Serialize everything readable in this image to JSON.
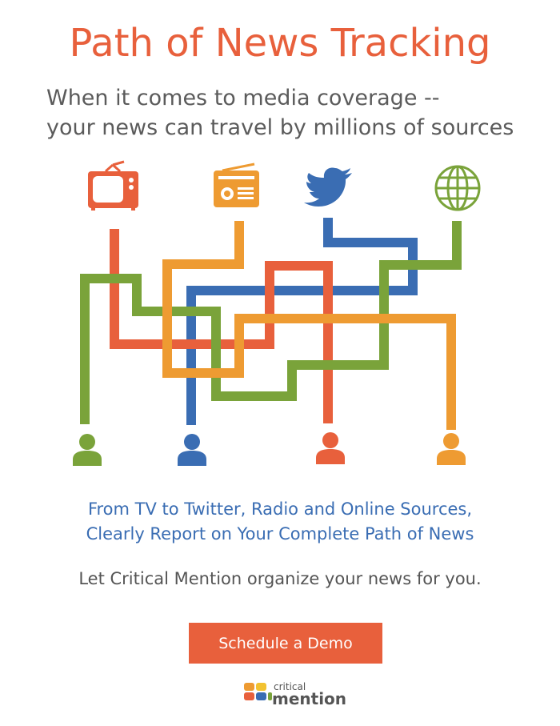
{
  "header": {
    "title": "Path of News Tracking",
    "subtitle_line1": "When it comes to media coverage --",
    "subtitle_line2": "your news can travel by millions of sources"
  },
  "diagram": {
    "sources": [
      {
        "icon": "tv-icon",
        "color": "#e8603c"
      },
      {
        "icon": "radio-icon",
        "color": "#ee9b32"
      },
      {
        "icon": "twitter-bird-icon",
        "color": "#3a6db3"
      },
      {
        "icon": "globe-icon",
        "color": "#7aa33a"
      }
    ],
    "audiences": [
      {
        "icon": "person-icon",
        "color": "#7aa33a"
      },
      {
        "icon": "person-icon",
        "color": "#3a6db3"
      },
      {
        "icon": "person-icon",
        "color": "#e8603c"
      },
      {
        "icon": "person-icon",
        "color": "#ee9b32"
      }
    ]
  },
  "tagline": {
    "line1": "From TV to Twitter, Radio and Online Sources,",
    "line2": "Clearly Report on Your Complete Path of News"
  },
  "cta": {
    "text": "Let Critical Mention organize your news for you.",
    "button_label": "Schedule a Demo"
  },
  "logo": {
    "small_text": "critical",
    "big_text": "mention",
    "colors": [
      "#ee9b32",
      "#f2c230",
      "#e8603c",
      "#3a6db3",
      "#7aa33a"
    ]
  },
  "colors": {
    "orange_red": "#e8603c",
    "orange": "#ee9b32",
    "blue": "#3a6db3",
    "green": "#7aa33a"
  }
}
